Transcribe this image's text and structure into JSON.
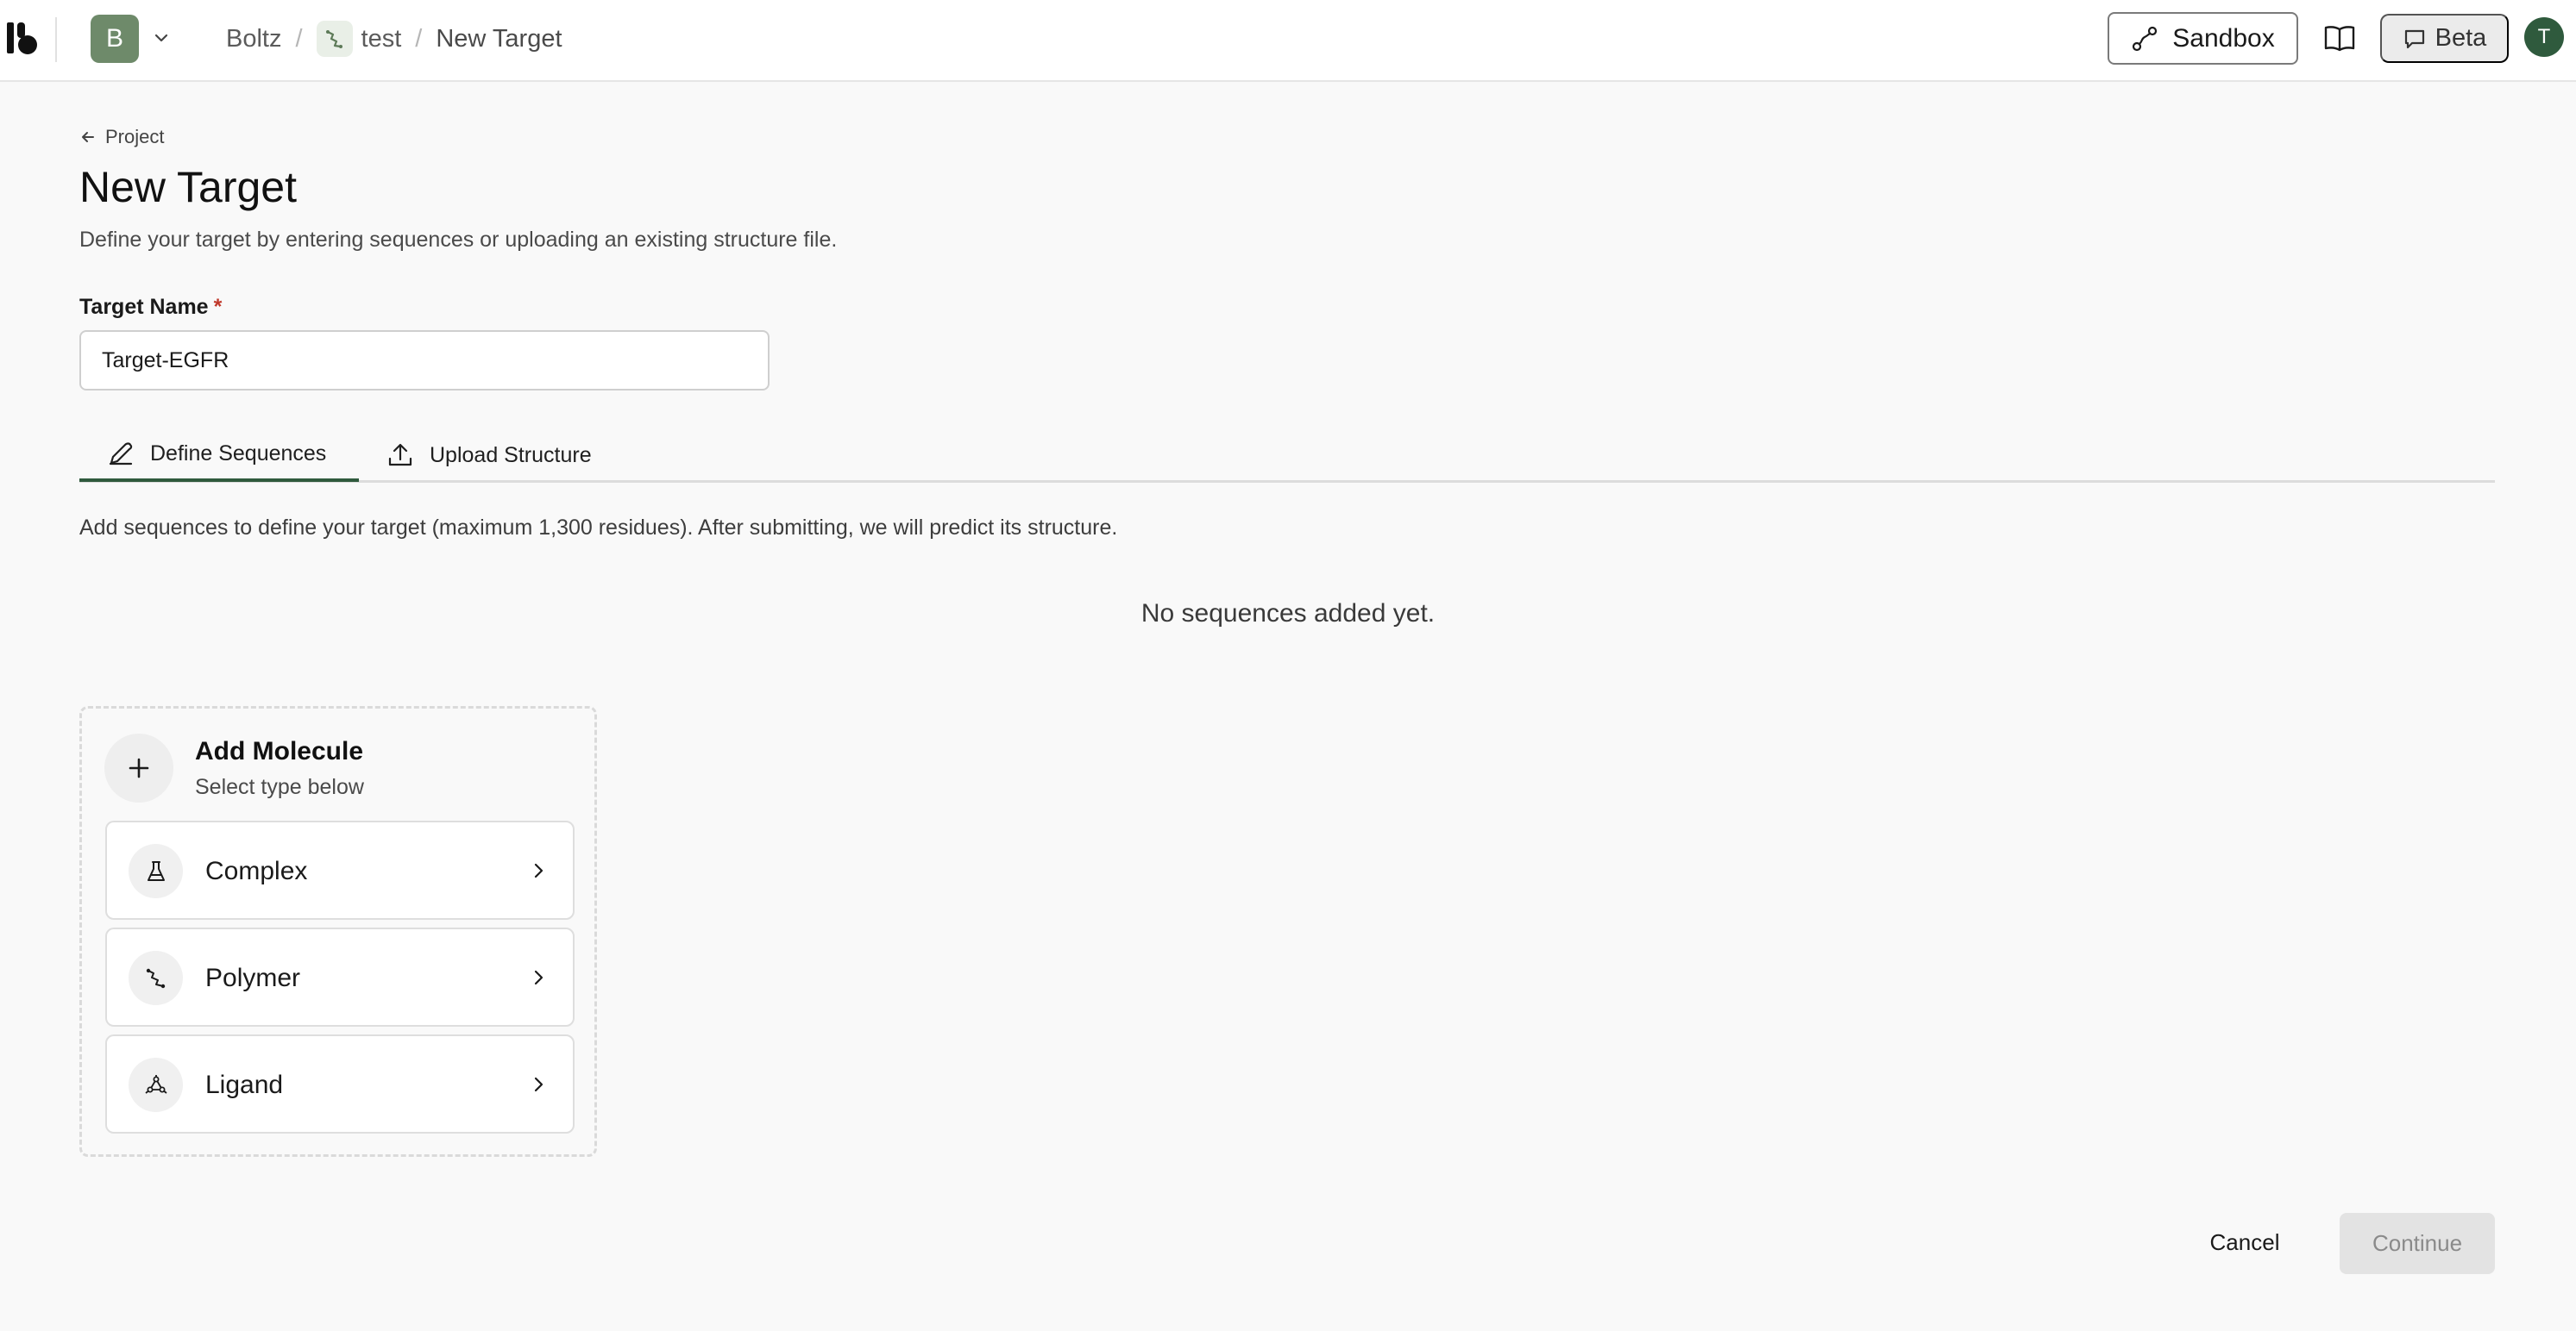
{
  "topbar": {
    "workspace_initial": "B",
    "breadcrumbs": {
      "org": "Boltz",
      "sep": "/",
      "project": "test",
      "current": "New Target"
    },
    "sandbox_label": "Sandbox",
    "beta_label": "Beta",
    "user_initial": "T"
  },
  "page": {
    "back_label": "Project",
    "title": "New Target",
    "subtitle": "Define your target by entering sequences or uploading an existing structure file."
  },
  "form": {
    "target_name_label": "Target Name",
    "required_mark": "*",
    "target_name_value": "Target-EGFR"
  },
  "tabs": [
    {
      "label": "Define Sequences",
      "icon": "pencil-icon",
      "active": true
    },
    {
      "label": "Upload Structure",
      "icon": "upload-icon",
      "active": false
    }
  ],
  "sequences": {
    "help_text": "Add sequences to define your target (maximum 1,300 residues). After submitting, we will predict its structure.",
    "empty_text": "No sequences added yet."
  },
  "add_molecule": {
    "title": "Add Molecule",
    "subtitle": "Select type below",
    "options": [
      {
        "label": "Complex",
        "icon": "flask-icon"
      },
      {
        "label": "Polymer",
        "icon": "polymer-icon"
      },
      {
        "label": "Ligand",
        "icon": "ligand-icon"
      }
    ]
  },
  "footer": {
    "cancel_label": "Cancel",
    "continue_label": "Continue"
  },
  "colors": {
    "accent": "#2f5a3d",
    "workspace_avatar": "#6e8a6a",
    "required": "#c0392b"
  }
}
